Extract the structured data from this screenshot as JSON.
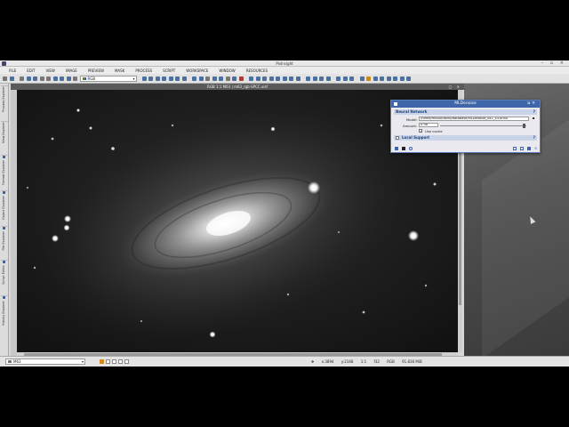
{
  "window": {
    "title": "PixInsight",
    "controls": "– ▫ ×"
  },
  "menu": [
    "FILE",
    "EDIT",
    "VIEW",
    "IMAGE",
    "PREVIEW",
    "MASK",
    "PROCESS",
    "SCRIPT",
    "WORKSPACE",
    "WINDOW",
    "RESOURCES"
  ],
  "toolbar": {
    "channel_select": "RGB"
  },
  "left_tabs": [
    "Process Explorer",
    "View Explorer",
    "Format Explorer",
    "Object Explorer",
    "File Explorer",
    "Script Editor",
    "History Explorer"
  ],
  "image_window": {
    "title": "RGB 1:1 M63 | m63_rgb-SPCC.xisf",
    "controls": "▢ ✕"
  },
  "statusbar": {
    "view_select": "M63",
    "coords": "x:3894",
    "yinfo": "y:2168",
    "zoom": "1:1",
    "bits": "f32",
    "mode": "RGB",
    "size": "91.836 MiB"
  },
  "dialog": {
    "title": "MLDenoise",
    "section1": "Neural Network",
    "model_label": "Model:",
    "model_path": "/home/mnoor/astro/database/MLDenoise_v41_v3.onnx",
    "amount_label": "Amount:",
    "amount_value": "0.98",
    "use_cache_label": "Use cache",
    "section2": "Local Support",
    "help": "?"
  }
}
